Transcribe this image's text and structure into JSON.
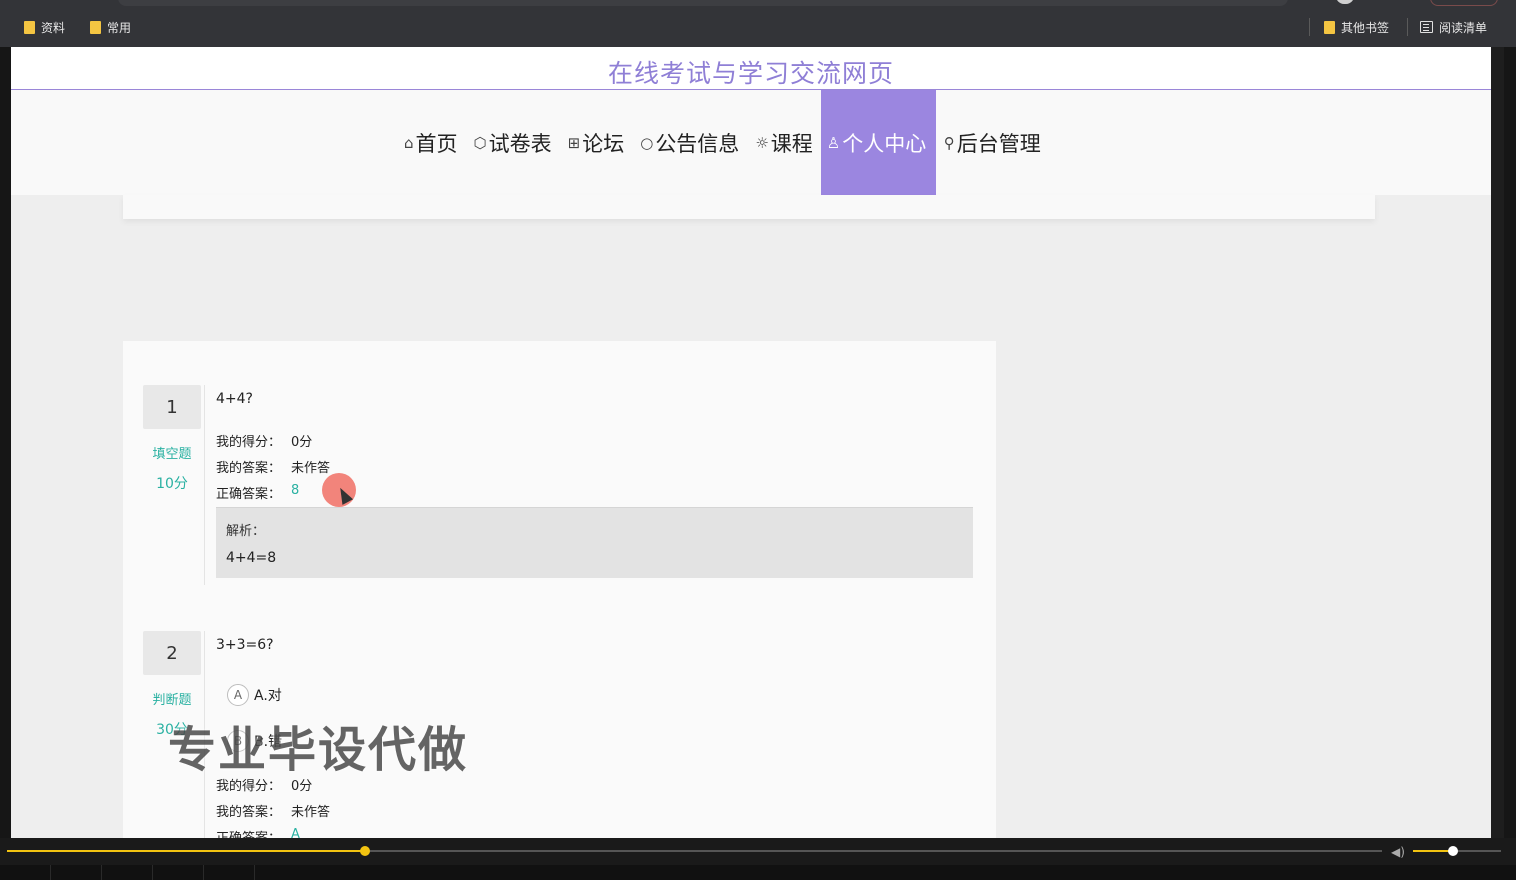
{
  "browser": {
    "bookmarks_left": [
      {
        "label": "资料",
        "icon": "folder-icon"
      },
      {
        "label": "常用",
        "icon": "folder-icon"
      }
    ],
    "bookmarks_right": [
      {
        "label": "其他书签",
        "icon": "folder-icon"
      },
      {
        "label": "阅读清单",
        "icon": "reading-list-icon"
      }
    ]
  },
  "site": {
    "title": "在线考试与学习交流网页",
    "accent_color": "#9b86e0",
    "nav": [
      {
        "icon": "⌂",
        "label": "首页",
        "active": false
      },
      {
        "icon": "⬡",
        "label": "试卷表",
        "active": false
      },
      {
        "icon": "⊞",
        "label": "论坛",
        "active": false
      },
      {
        "icon": "○",
        "label": "公告信息",
        "active": false
      },
      {
        "icon": "☼",
        "label": "课程",
        "active": false
      },
      {
        "icon": "♙",
        "label": "个人中心",
        "active": true
      },
      {
        "icon": "⚲",
        "label": "后台管理",
        "active": false
      }
    ]
  },
  "questions": [
    {
      "number": "1",
      "type": "填空题",
      "score": "10分",
      "text": "4+4?",
      "my_score_label": "我的得分：",
      "my_score": "0分",
      "my_answer_label": "我的答案：",
      "my_answer": "未作答",
      "correct_label": "正确答案：",
      "correct": "8",
      "analysis_label": "解析：",
      "analysis": "4+4=8"
    },
    {
      "number": "2",
      "type": "判断题",
      "score": "30分",
      "text": "3+3=6?",
      "options": [
        {
          "letter": "A",
          "label": "A.对"
        },
        {
          "letter": "B",
          "label": "B.错"
        }
      ],
      "my_score_label": "我的得分：",
      "my_score": "0分",
      "my_answer_label": "我的答案：",
      "my_answer": "未作答",
      "correct_label": "正确答案：",
      "correct": "A"
    }
  ],
  "watermark": "专业毕设代做",
  "player": {
    "progress": 0.26,
    "volume": 0.45
  }
}
